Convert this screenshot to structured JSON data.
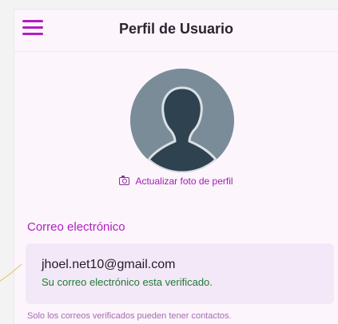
{
  "header": {
    "title": "Perfil de Usuario",
    "menu_icon": "hamburger-icon"
  },
  "profile": {
    "avatar_icon": "person-silhouette-icon",
    "photo_action": {
      "icon": "camera-icon",
      "label": "Actualizar foto de perfil"
    }
  },
  "email_section": {
    "label": "Correo electrónico",
    "value": "jhoel.net10@gmail.com",
    "status": "Su correo electrónico esta verificado.",
    "note": "Solo los correos verificados pueden tener contactos."
  },
  "colors": {
    "accent": "#b11fbf",
    "verified": "#1f7a37",
    "card_background": "#f3e8f7",
    "page_background": "#fcf5fc"
  }
}
